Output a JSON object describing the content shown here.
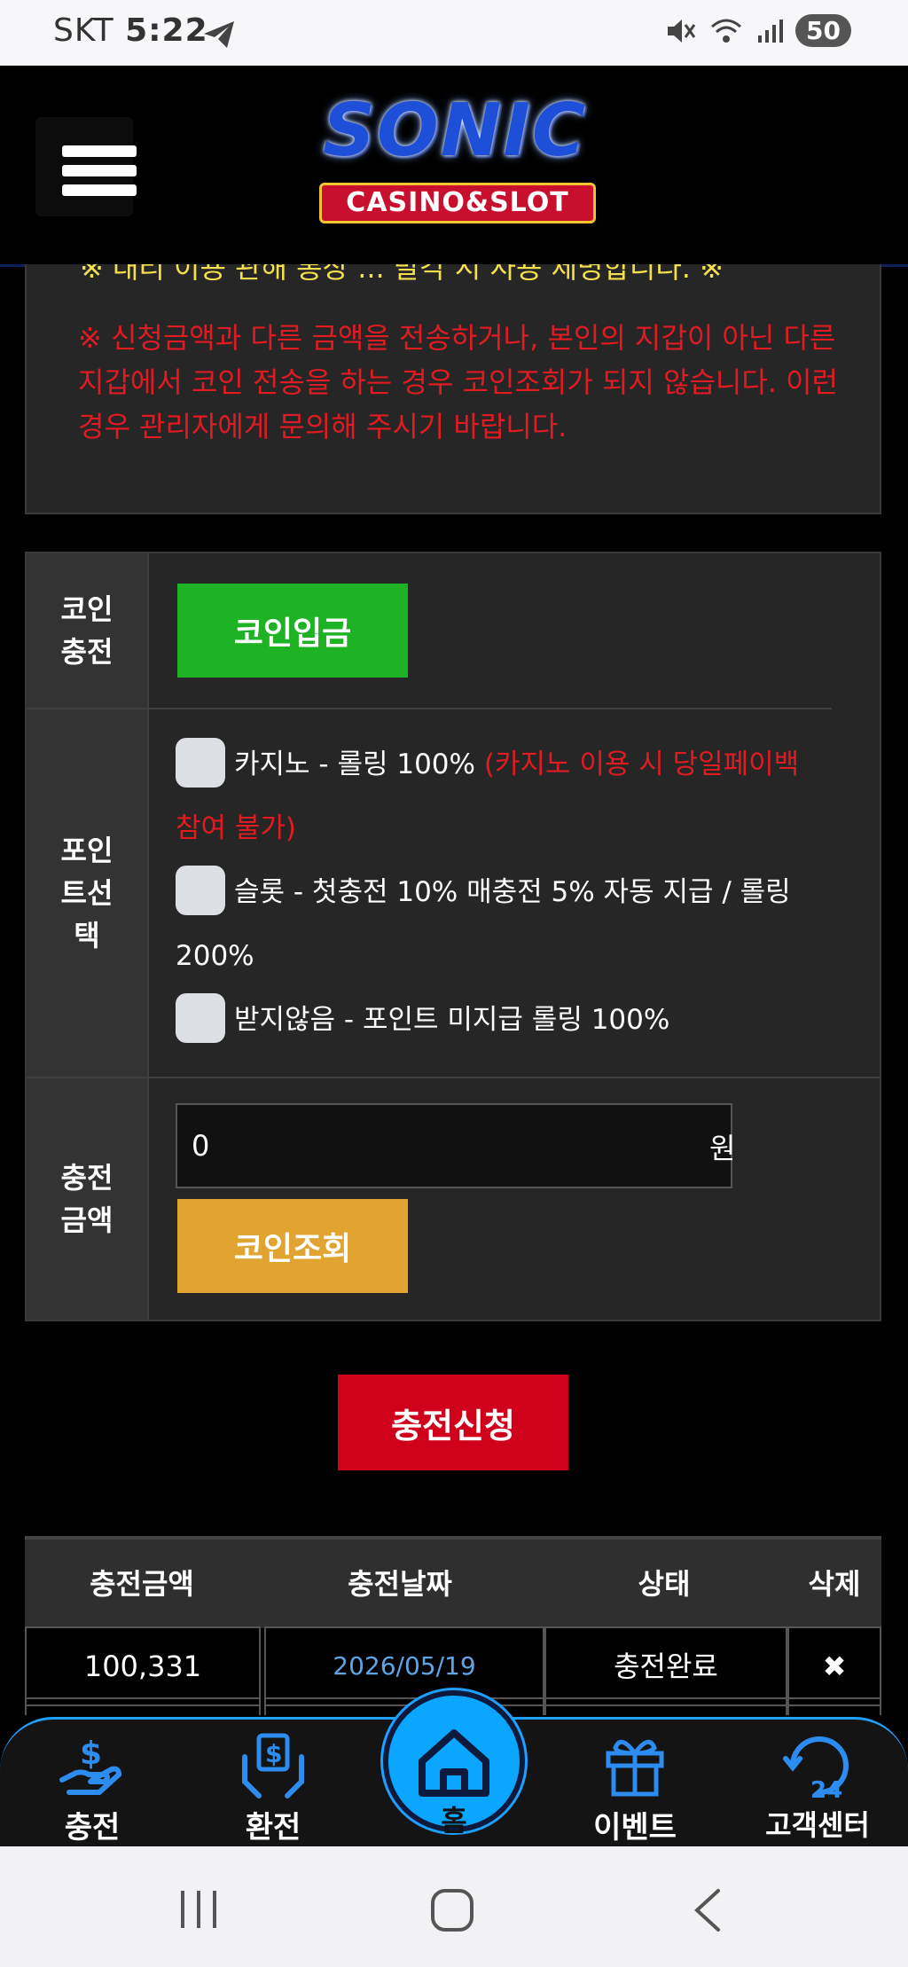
{
  "status_bar": {
    "carrier": "SKT",
    "time": "5:22",
    "battery": "50"
  },
  "header": {
    "logo_main": "SONIC",
    "logo_sub": "CASINO&SLOT"
  },
  "notice": {
    "cut_line": "※ 대리 이용 관해 통장 ... 발각 시 사용 제명합니다. ※",
    "text": "※ 신청금액과 다른 금액을 전송하거나, 본인의 지갑이 아닌 다른 지갑에서 코인 전송을 하는 경우 코인조회가 되지 않습니다. 이런 경우 관리자에게 문의해 주시기 바랍니다."
  },
  "form": {
    "coin_label_1": "코인",
    "coin_label_2": "충전",
    "coin_button": "코인입금",
    "point_label_1": "포인",
    "point_label_2": "트선",
    "point_label_3": "택",
    "options": [
      {
        "text": "카지노 - 롤링 100% ",
        "note": "(카지노 이용 시 당일페이백 참여 불가)"
      },
      {
        "text": "슬롯 - 첫충전 10% 매충전 5% 자동 지급 / 롤링 200%",
        "note": ""
      },
      {
        "text": "받지않음 - 포인트 미지급 롤링 100%",
        "note": ""
      }
    ],
    "amount_label_1": "충전",
    "amount_label_2": "금액",
    "amount_value": "0",
    "currency": "원",
    "check_button": "코인조회"
  },
  "submit_button": "충전신청",
  "history": {
    "headers": [
      "충전금액",
      "충전날짜",
      "상태",
      "삭제"
    ],
    "rows": [
      {
        "amount": "100,331",
        "date": "2026/05/19",
        "status": "충전완료",
        "delete": "✖"
      }
    ]
  },
  "bottom_nav": {
    "charge": "충전",
    "exchange": "환전",
    "home": "홈",
    "event": "이벤트",
    "support": "고객센터"
  },
  "colors": {
    "accent_blue": "#1ea0ff",
    "green": "#1db325",
    "yellow": "#e2a430",
    "red": "#d0021b"
  }
}
